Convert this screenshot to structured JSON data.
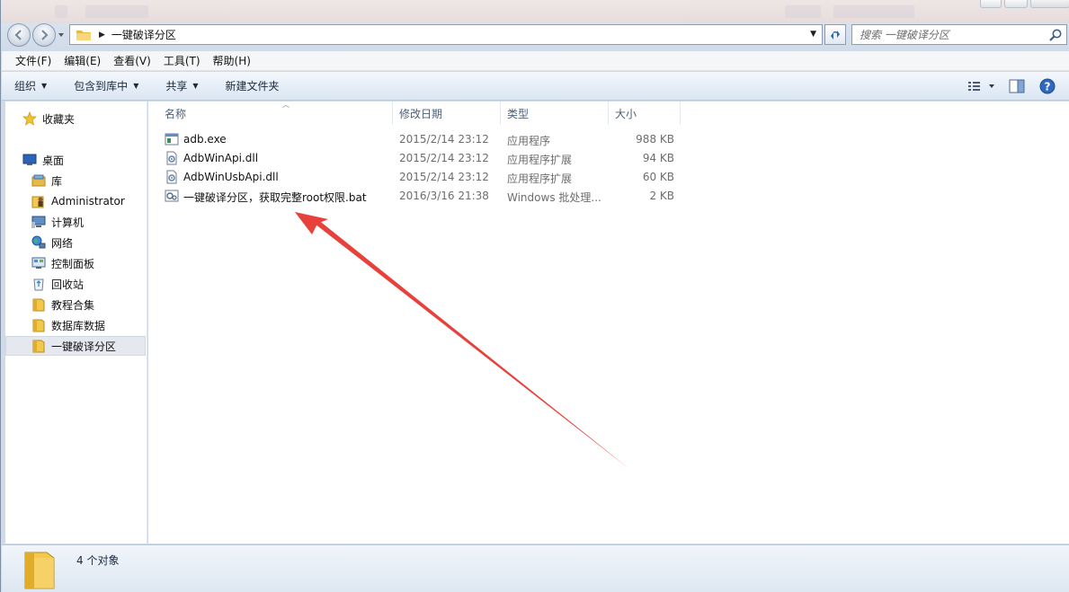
{
  "address": {
    "crumb": "一键破译分区",
    "search_placeholder": "搜索 一键破译分区"
  },
  "menu": [
    "文件(F)",
    "编辑(E)",
    "查看(V)",
    "工具(T)",
    "帮助(H)"
  ],
  "commands": {
    "organize": "组织",
    "include_library": "包含到库中",
    "share": "共享",
    "new_folder": "新建文件夹"
  },
  "nav": {
    "favorites": "收藏夹",
    "desktop": "桌面",
    "libraries": "库",
    "administrator": "Administrator",
    "computer": "计算机",
    "network": "网络",
    "control_panel": "控制面板",
    "recycle_bin": "回收站",
    "tutorials": "教程合集",
    "database": "数据库数据",
    "current": "一键破译分区"
  },
  "columns": {
    "name": "名称",
    "date": "修改日期",
    "type": "类型",
    "size": "大小"
  },
  "files": [
    {
      "name": "adb.exe",
      "date": "2015/2/14 23:12",
      "type": "应用程序",
      "size": "988 KB",
      "icon": "exe-icon"
    },
    {
      "name": "AdbWinApi.dll",
      "date": "2015/2/14 23:12",
      "type": "应用程序扩展",
      "size": "94 KB",
      "icon": "dll-icon"
    },
    {
      "name": "AdbWinUsbApi.dll",
      "date": "2015/2/14 23:12",
      "type": "应用程序扩展",
      "size": "60 KB",
      "icon": "dll-icon"
    },
    {
      "name": "一键破译分区，获取完整root权限.bat",
      "date": "2016/3/16 21:38",
      "type": "Windows 批处理...",
      "size": "2 KB",
      "icon": "bat-icon"
    }
  ],
  "status": {
    "count": "4 个对象"
  },
  "colors": {
    "annotation_arrow": "#e8403a",
    "folder_yellow": "#f2c94c"
  }
}
